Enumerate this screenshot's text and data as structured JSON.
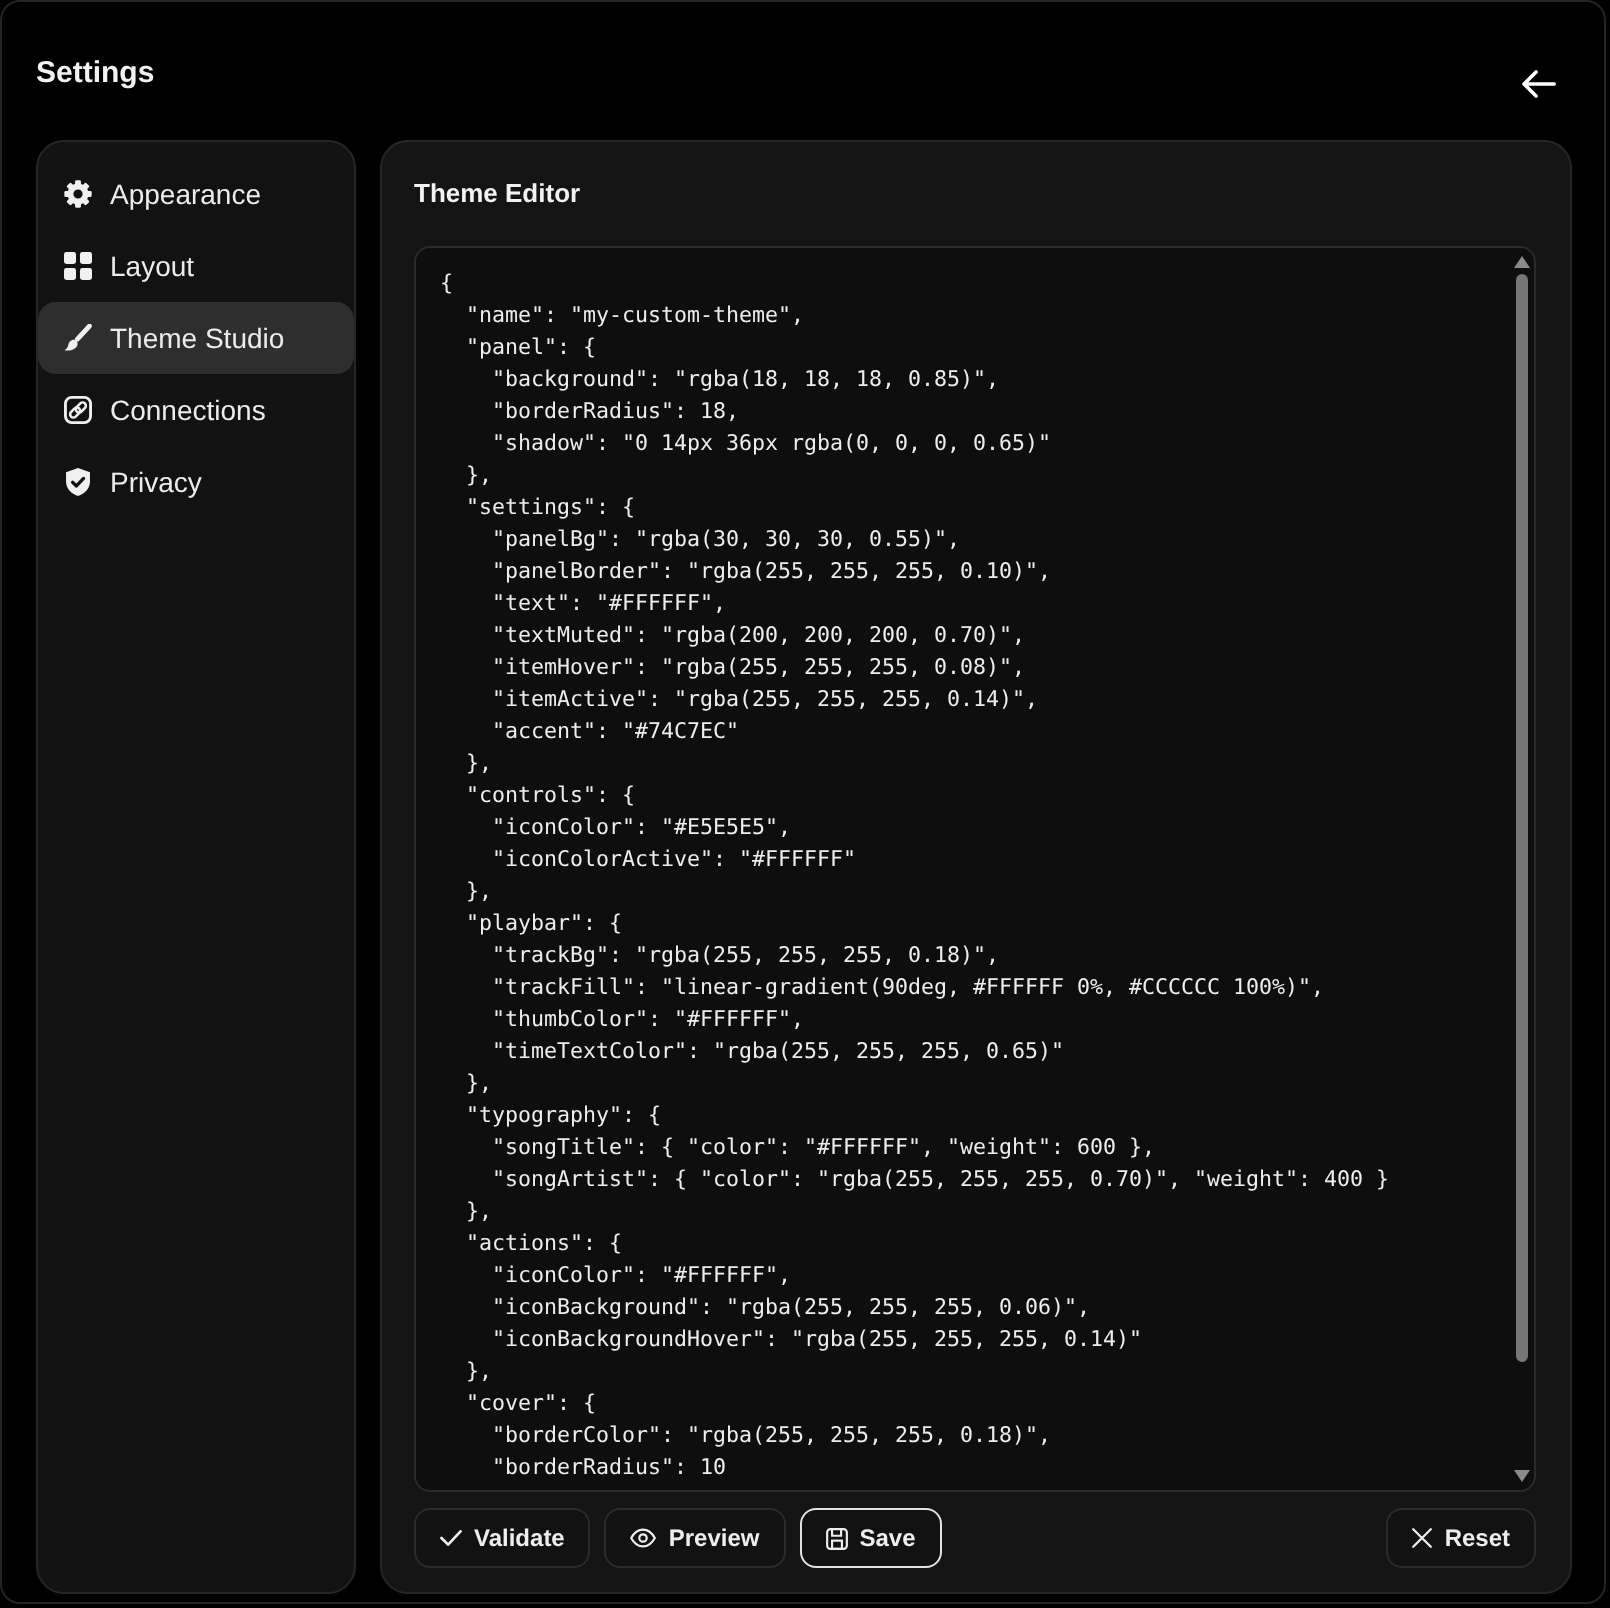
{
  "header": {
    "title": "Settings"
  },
  "sidebar": {
    "items": [
      {
        "label": "Appearance",
        "selected": false
      },
      {
        "label": "Layout",
        "selected": false
      },
      {
        "label": "Theme Studio",
        "selected": true
      },
      {
        "label": "Connections",
        "selected": false
      },
      {
        "label": "Privacy",
        "selected": false
      }
    ]
  },
  "panel": {
    "title": "Theme Editor",
    "editor": {
      "value": "{\n  \"name\": \"my-custom-theme\",\n  \"panel\": {\n    \"background\": \"rgba(18, 18, 18, 0.85)\",\n    \"borderRadius\": 18,\n    \"shadow\": \"0 14px 36px rgba(0, 0, 0, 0.65)\"\n  },\n  \"settings\": {\n    \"panelBg\": \"rgba(30, 30, 30, 0.55)\",\n    \"panelBorder\": \"rgba(255, 255, 255, 0.10)\",\n    \"text\": \"#FFFFFF\",\n    \"textMuted\": \"rgba(200, 200, 200, 0.70)\",\n    \"itemHover\": \"rgba(255, 255, 255, 0.08)\",\n    \"itemActive\": \"rgba(255, 255, 255, 0.14)\",\n    \"accent\": \"#74C7EC\"\n  },\n  \"controls\": {\n    \"iconColor\": \"#E5E5E5\",\n    \"iconColorActive\": \"#FFFFFF\"\n  },\n  \"playbar\": {\n    \"trackBg\": \"rgba(255, 255, 255, 0.18)\",\n    \"trackFill\": \"linear-gradient(90deg, #FFFFFF 0%, #CCCCCC 100%)\",\n    \"thumbColor\": \"#FFFFFF\",\n    \"timeTextColor\": \"rgba(255, 255, 255, 0.65)\"\n  },\n  \"typography\": {\n    \"songTitle\": { \"color\": \"#FFFFFF\", \"weight\": 600 },\n    \"songArtist\": { \"color\": \"rgba(255, 255, 255, 0.70)\", \"weight\": 400 }\n  },\n  \"actions\": {\n    \"iconColor\": \"#FFFFFF\",\n    \"iconBackground\": \"rgba(255, 255, 255, 0.06)\",\n    \"iconBackgroundHover\": \"rgba(255, 255, 255, 0.14)\"\n  },\n  \"cover\": {\n    \"borderColor\": \"rgba(255, 255, 255, 0.18)\",\n    \"borderRadius\": 10"
    }
  },
  "buttons": [
    {
      "label": "Validate",
      "focused": false
    },
    {
      "label": "Preview",
      "focused": false
    },
    {
      "label": "Save",
      "focused": true
    }
  ],
  "reset_button": {
    "label": "Reset"
  }
}
